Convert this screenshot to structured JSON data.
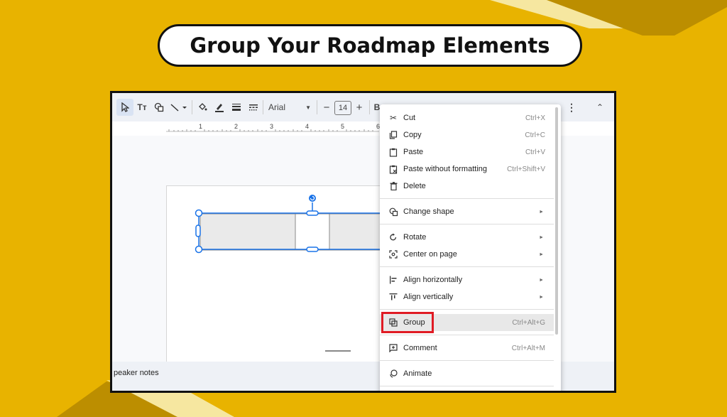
{
  "title": "Group Your Roadmap Elements",
  "toolbar": {
    "font": "Arial",
    "font_size": "14",
    "minus": "−",
    "plus": "+",
    "bold": "B"
  },
  "ruler": {
    "ticks": [
      "1",
      "2",
      "3",
      "4",
      "5",
      "6"
    ]
  },
  "notes": {
    "label": "peaker notes"
  },
  "menu": {
    "cut": {
      "label": "Cut",
      "shortcut": "Ctrl+X"
    },
    "copy": {
      "label": "Copy",
      "shortcut": "Ctrl+C"
    },
    "paste": {
      "label": "Paste",
      "shortcut": "Ctrl+V"
    },
    "paste_plain": {
      "label": "Paste without formatting",
      "shortcut": "Ctrl+Shift+V"
    },
    "delete": {
      "label": "Delete"
    },
    "change_shape": {
      "label": "Change shape"
    },
    "rotate": {
      "label": "Rotate"
    },
    "center": {
      "label": "Center on page"
    },
    "align_h": {
      "label": "Align horizontally"
    },
    "align_v": {
      "label": "Align vertically"
    },
    "group": {
      "label": "Group",
      "shortcut": "Ctrl+Alt+G"
    },
    "comment": {
      "label": "Comment",
      "shortcut": "Ctrl+Alt+M"
    },
    "animate": {
      "label": "Animate"
    }
  },
  "colors": {
    "background": "#E8B300",
    "selection": "#1a73e8",
    "highlight_box": "#e01b24"
  }
}
